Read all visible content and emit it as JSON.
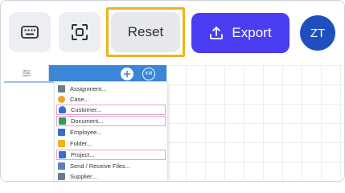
{
  "toolbar": {
    "keyboard_icon": "keyboard-icon",
    "focus_icon": "focus-frame-icon",
    "reset_label": "Reset",
    "export_label": "Export",
    "export_icon": "upload-icon",
    "avatar_initials": "ZT"
  },
  "colors": {
    "accent": "#4a3cf0",
    "avatar": "#1f4fbf",
    "highlight": "#f0b31c",
    "menu_highlight": "#e6a1d2",
    "app_bar": "#3a86d8"
  },
  "embedded": {
    "menu_icon": "list-icon",
    "add_icon": "plus-icon",
    "user_initials": "KM",
    "menu": {
      "items": [
        {
          "label": "Assignment...",
          "icon": "assignment-icon",
          "color": "#6b7c93"
        },
        {
          "label": "Case...",
          "icon": "case-icon",
          "color": "#f0a030"
        },
        {
          "label": "Customer...",
          "icon": "people-icon",
          "color": "#2f6fd6"
        },
        {
          "label": "Document...",
          "icon": "document-icon",
          "color": "#2d9f55"
        },
        {
          "label": "Employee...",
          "icon": "employee-icon",
          "color": "#2f6fd6"
        },
        {
          "label": "Folder...",
          "icon": "folder-icon",
          "color": "#f3b21f"
        },
        {
          "label": "Project...",
          "icon": "project-icon",
          "color": "#2f6fd6"
        },
        {
          "label": "Send / Receive Files...",
          "icon": "send-files-icon",
          "color": "#5f7dbf"
        },
        {
          "label": "Supplier...",
          "icon": "supplier-icon",
          "color": "#6b7c93"
        }
      ]
    }
  }
}
